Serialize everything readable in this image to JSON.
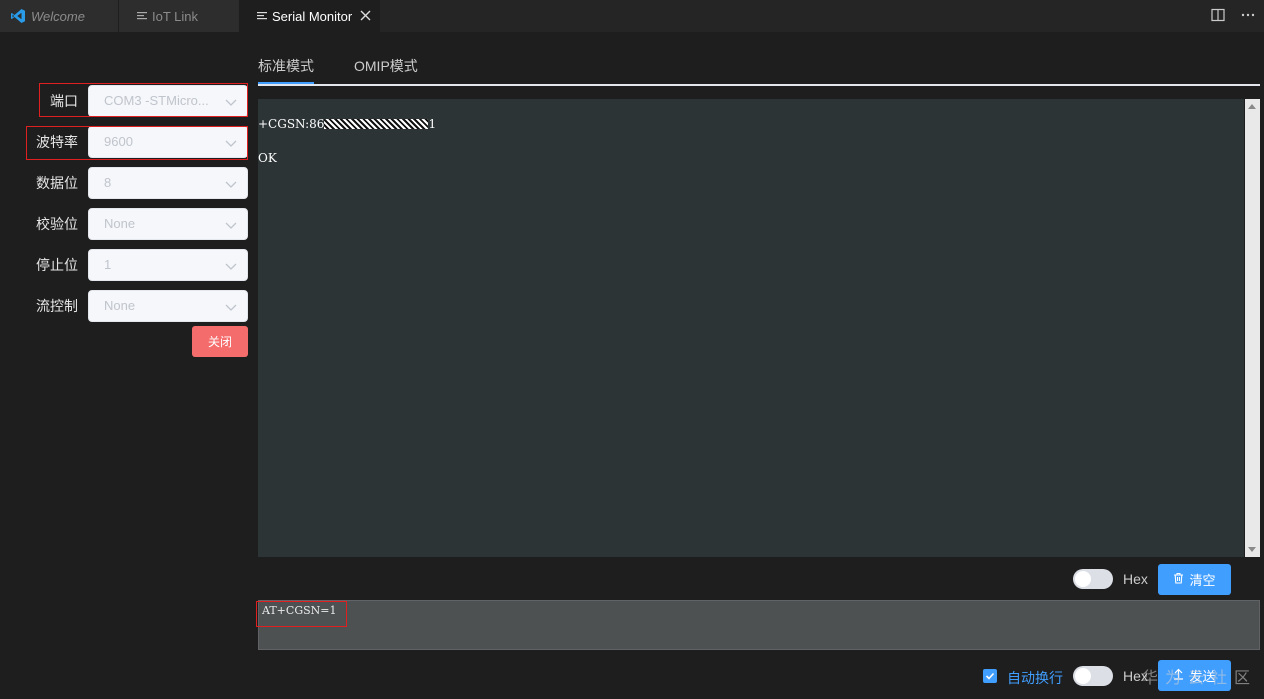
{
  "tabs": [
    {
      "label": "Welcome"
    },
    {
      "label": "IoT Link"
    },
    {
      "label": "Serial Monitor"
    }
  ],
  "colors": {
    "accent": "#409eff",
    "danger": "#f56c6c",
    "output_bg": "#2c3436",
    "highlight_box": "#e02020"
  },
  "form": {
    "port": {
      "label": "端口",
      "value": "COM3 -STMicro..."
    },
    "baud": {
      "label": "波特率",
      "value": "9600"
    },
    "databits": {
      "label": "数据位",
      "value": "8"
    },
    "parity": {
      "label": "校验位",
      "value": "None"
    },
    "stopbits": {
      "label": "停止位",
      "value": "1"
    },
    "flow": {
      "label": "流控制",
      "value": "None"
    },
    "close_label": "关闭"
  },
  "modes": {
    "standard": "标准模式",
    "omip": "OMIP模式"
  },
  "output": {
    "line1_prefix": "+CGSN:86",
    "line1_suffix": "1",
    "line2": "OK"
  },
  "controls": {
    "hex_label": "Hex",
    "clear_label": "清空",
    "input_value": "AT+CGSN=1",
    "auto_newline_label": "自动换行",
    "send_label": "发送",
    "watermark": "华为云社区"
  }
}
